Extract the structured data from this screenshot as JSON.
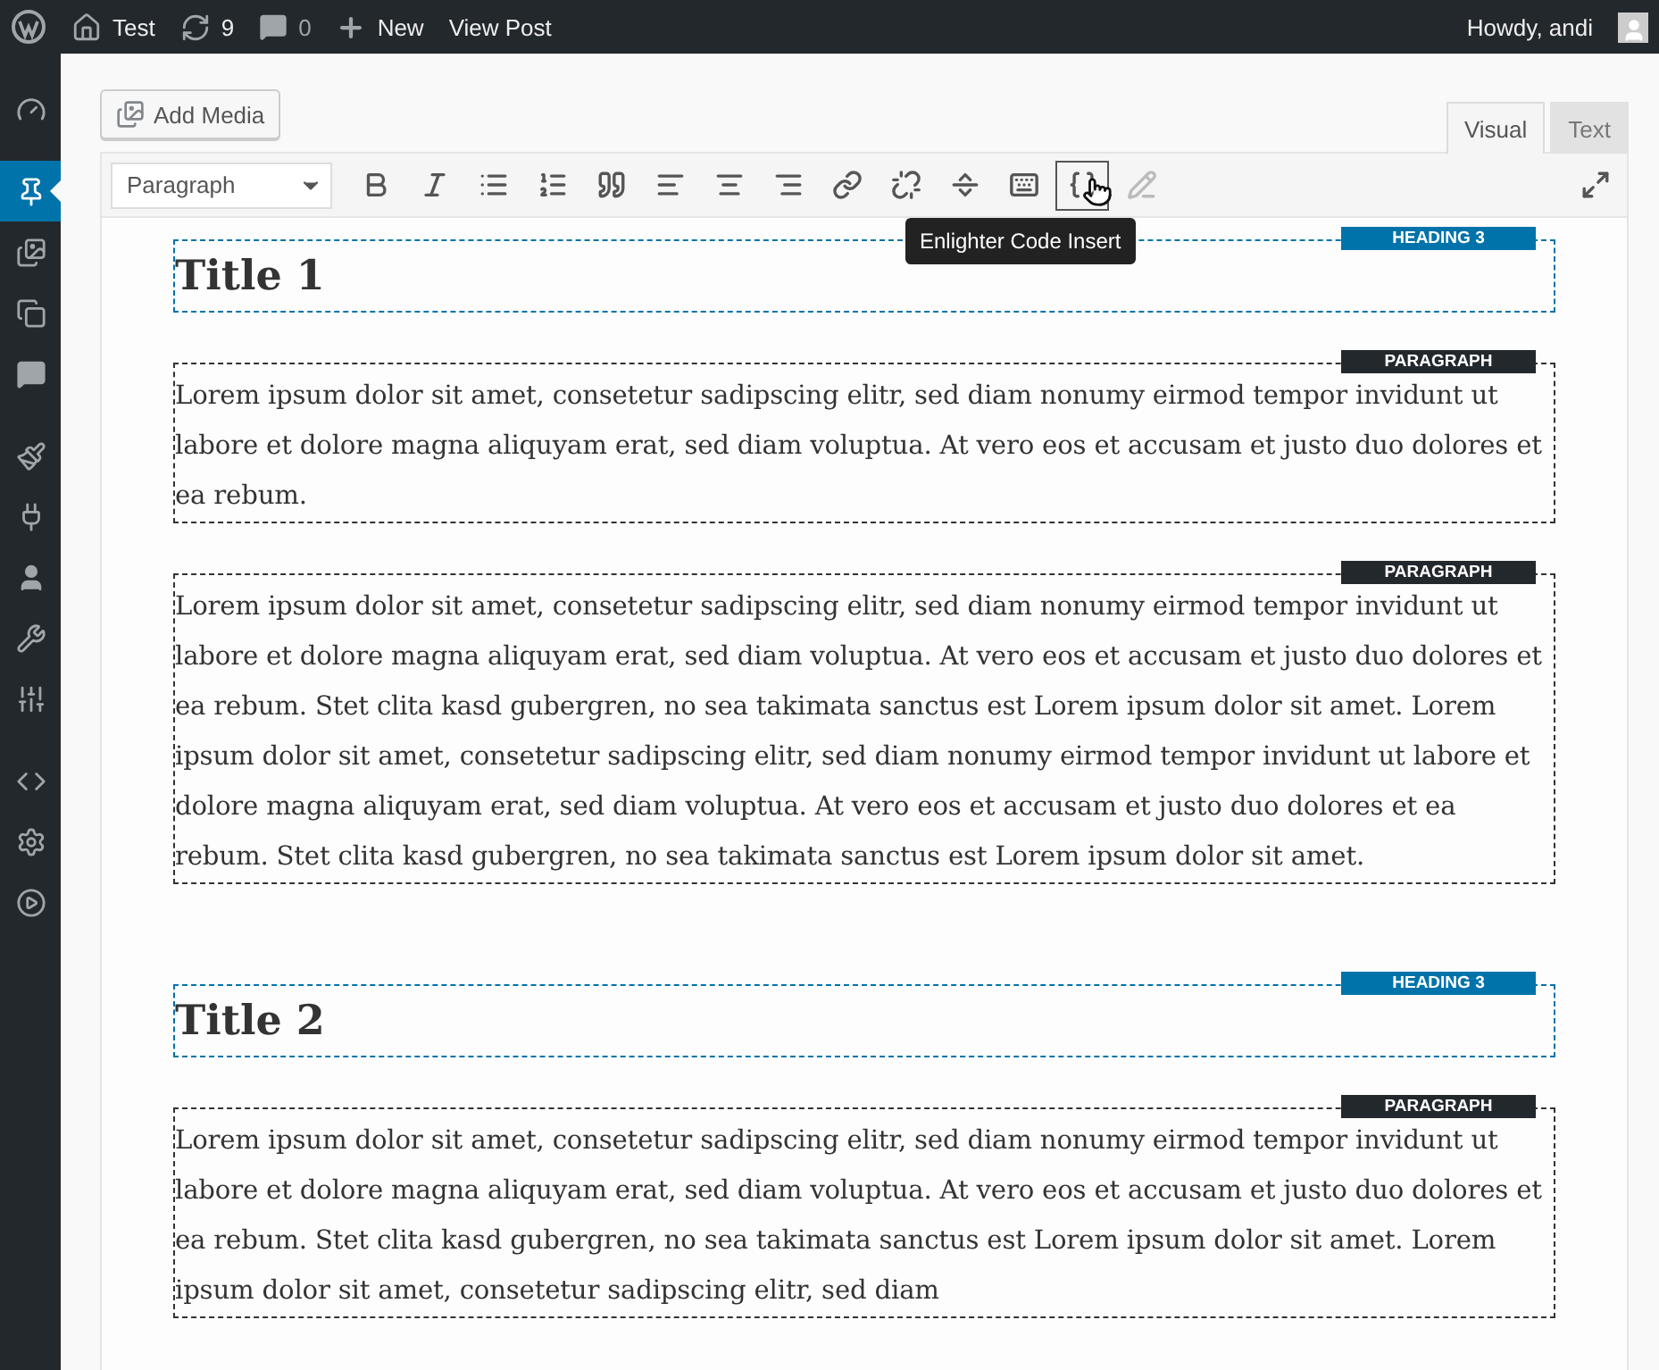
{
  "admin_bar": {
    "site": "Test",
    "updates": "9",
    "comments": "0",
    "new": "New",
    "view": "View Post",
    "account": "Howdy, andi"
  },
  "sidebar": {
    "items": [
      {
        "kind": "dashboard",
        "selected": false
      },
      {
        "kind": "posts",
        "selected": true
      },
      {
        "kind": "media",
        "selected": false
      },
      {
        "kind": "pages",
        "selected": false
      },
      {
        "kind": "comments",
        "selected": false
      },
      {
        "kind": "appearance",
        "selected": false
      },
      {
        "kind": "plugins",
        "selected": false
      },
      {
        "kind": "users",
        "selected": false
      },
      {
        "kind": "tools",
        "selected": false
      },
      {
        "kind": "settings",
        "selected": false
      },
      {
        "kind": "code",
        "selected": false
      },
      {
        "kind": "gear",
        "selected": false
      },
      {
        "kind": "play",
        "selected": false
      }
    ]
  },
  "add_media": "Add Media",
  "tabs": [
    {
      "label": "Visual",
      "selected": true
    },
    {
      "label": "Text",
      "selected": false
    }
  ],
  "toolbar": {
    "format": "Paragraph",
    "buttons": [
      {
        "kind": "bold",
        "hovered": false,
        "disabled": false
      },
      {
        "kind": "italic",
        "hovered": false,
        "disabled": false
      },
      {
        "kind": "bullets",
        "hovered": false,
        "disabled": false
      },
      {
        "kind": "numbers",
        "hovered": false,
        "disabled": false
      },
      {
        "kind": "quote",
        "hovered": false,
        "disabled": false
      },
      {
        "kind": "align-left",
        "hovered": false,
        "disabled": false
      },
      {
        "kind": "align-center",
        "hovered": false,
        "disabled": false
      },
      {
        "kind": "align-right",
        "hovered": false,
        "disabled": false
      },
      {
        "kind": "link",
        "hovered": false,
        "disabled": false
      },
      {
        "kind": "unlink",
        "hovered": false,
        "disabled": false
      },
      {
        "kind": "more",
        "hovered": false,
        "disabled": false
      },
      {
        "kind": "keyboard",
        "hovered": false,
        "disabled": false
      },
      {
        "kind": "code-insert",
        "hovered": true,
        "disabled": false
      },
      {
        "kind": "code-edit",
        "hovered": false,
        "disabled": true
      }
    ],
    "tooltip": "Enlighter Code Insert"
  },
  "blocks": [
    {
      "kind": "heading",
      "label": "HEADING 3",
      "text": "Title 1"
    },
    {
      "kind": "paragraph",
      "label": "PARAGRAPH",
      "text": "Lorem ipsum dolor sit amet, consetetur sadipscing elitr, sed diam nonumy eirmod tempor invidunt ut labore et dolore magna aliquyam erat, sed diam voluptua. At vero eos et accusam et justo duo dolores et ea rebum."
    },
    {
      "kind": "paragraph",
      "label": "PARAGRAPH",
      "text": "Lorem ipsum dolor sit amet, consetetur sadipscing elitr, sed diam nonumy eirmod tempor invidunt ut labore et dolore magna aliquyam erat, sed diam voluptua. At vero eos et accusam et justo duo dolores et ea rebum. Stet clita kasd gubergren, no sea takimata sanctus est Lorem ipsum dolor sit amet. Lorem ipsum dolor sit amet, consetetur sadipscing elitr, sed diam nonumy eirmod tempor invidunt ut labore et dolore magna aliquyam erat, sed diam voluptua. At vero eos et accusam et justo duo dolores et ea rebum. Stet clita kasd gubergren, no sea takimata sanctus est Lorem ipsum dolor sit amet."
    },
    {
      "kind": "spacer"
    },
    {
      "kind": "heading",
      "label": "HEADING 3",
      "text": "Title 2"
    },
    {
      "kind": "paragraph",
      "label": "PARAGRAPH",
      "text": "Lorem ipsum dolor sit amet, consetetur sadipscing elitr, sed diam nonumy eirmod tempor invidunt ut labore et dolore magna aliquyam erat, sed diam voluptua. At vero eos et accusam et justo duo dolores et ea rebum. Stet clita kasd gubergren, no sea takimata sanctus est Lorem ipsum dolor sit amet. Lorem ipsum dolor sit amet, consetetur sadipscing elitr, sed diam"
    }
  ]
}
